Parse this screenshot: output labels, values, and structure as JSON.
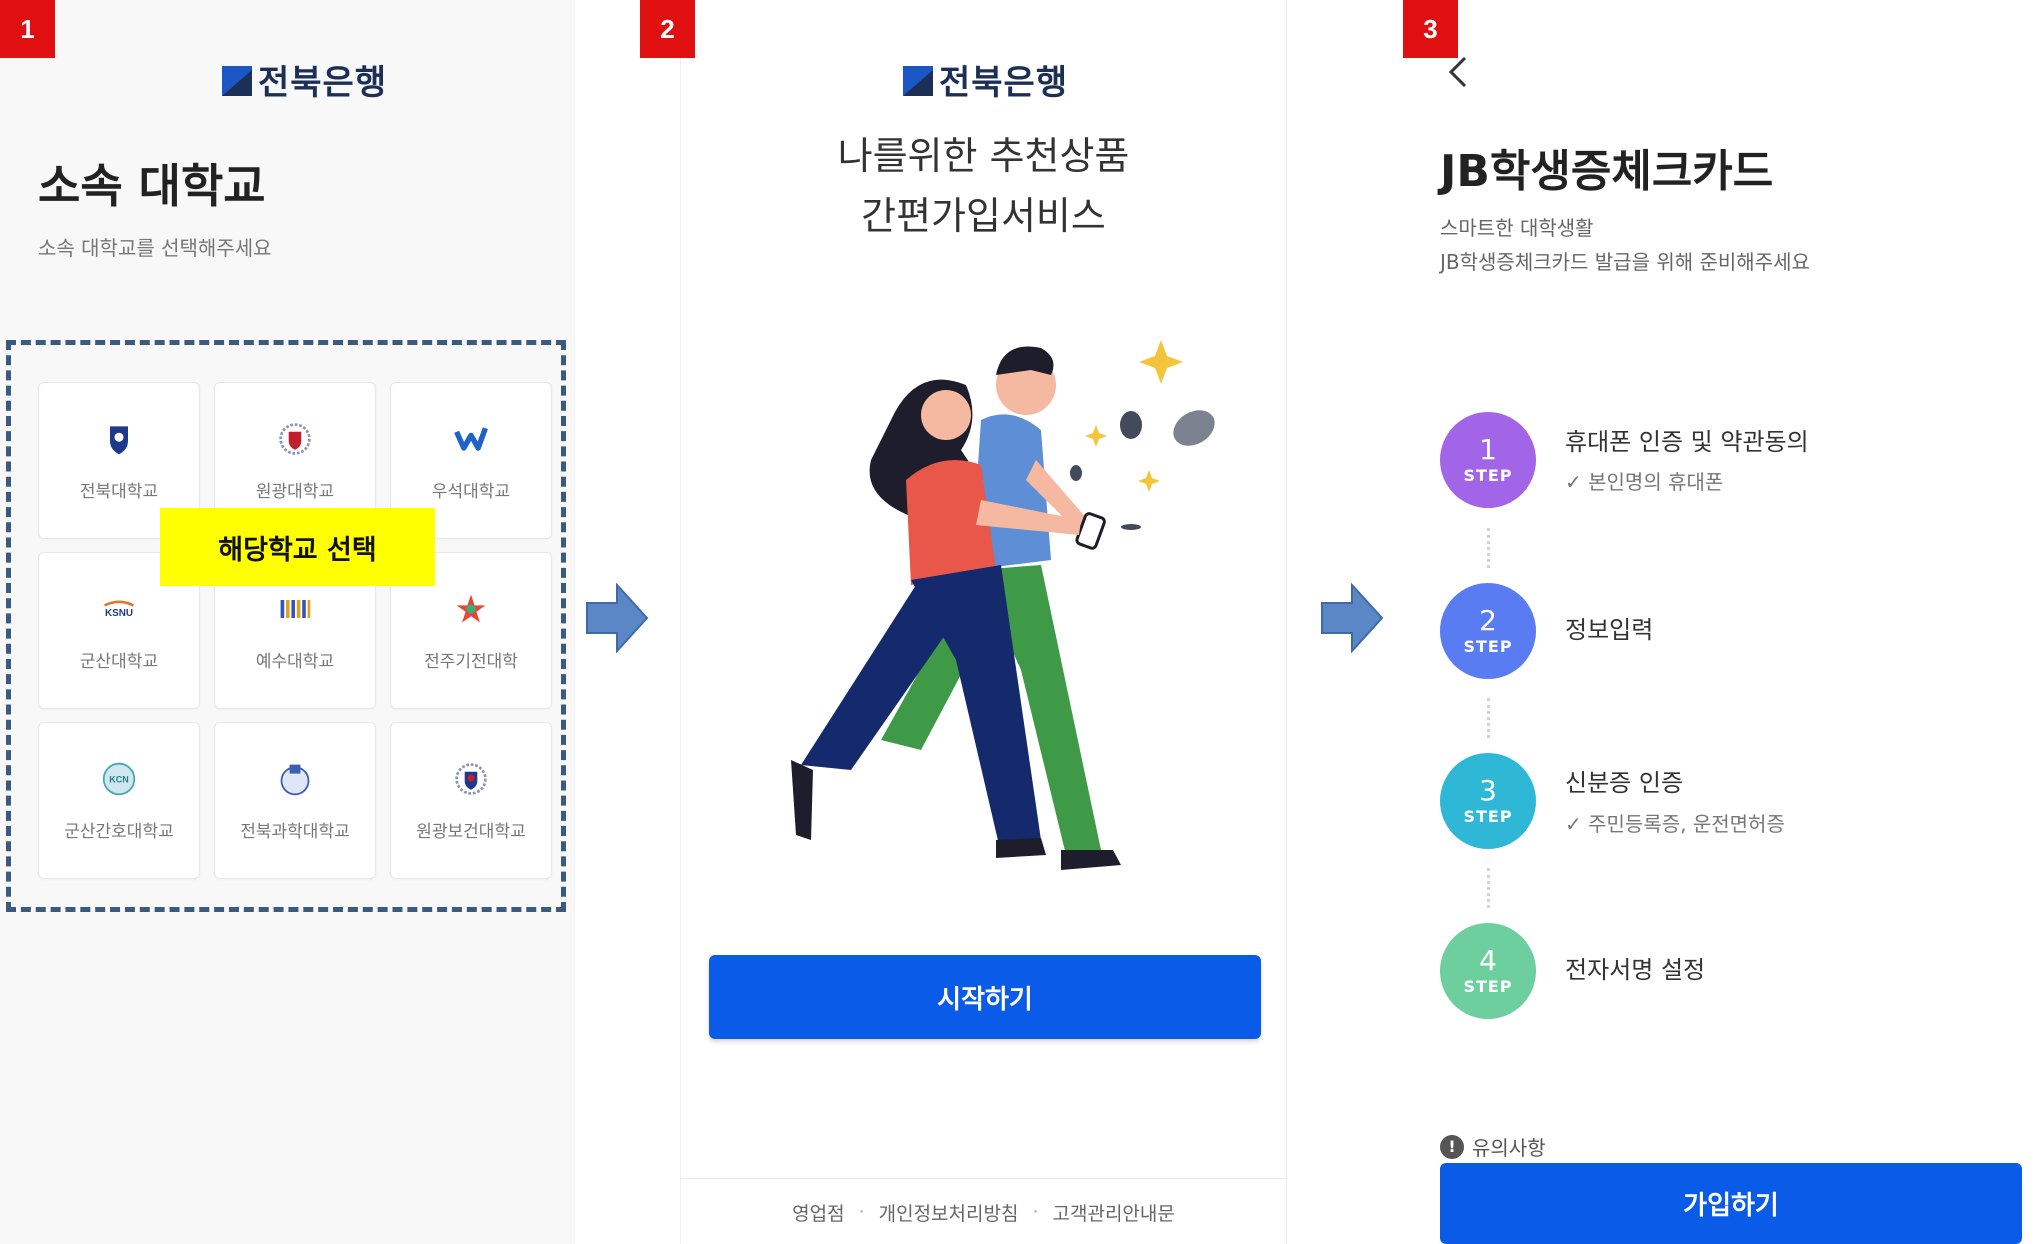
{
  "badges": [
    "1",
    "2",
    "3"
  ],
  "bank_logo": "전북은행",
  "panel1": {
    "title": "소속 대학교",
    "subtitle": "소속 대학교를 선택해주세요",
    "highlight": "해당학교 선택",
    "universities": [
      {
        "name": "전북대학교",
        "icon": "jbnu-crest-icon"
      },
      {
        "name": "원광대학교",
        "icon": "wku-crest-icon"
      },
      {
        "name": "우석대학교",
        "icon": "woosuk-w-icon"
      },
      {
        "name": "군산대학교",
        "icon": "ksnu-logo-icon"
      },
      {
        "name": "예수대학교",
        "icon": "jesus-univ-icon"
      },
      {
        "name": "전주기전대학",
        "icon": "kijeon-star-icon"
      },
      {
        "name": "군산간호대학교",
        "icon": "kcn-seal-icon"
      },
      {
        "name": "전북과학대학교",
        "icon": "jbsc-seal-icon"
      },
      {
        "name": "원광보건대학교",
        "icon": "wkhc-crest-icon"
      }
    ]
  },
  "panel2": {
    "headline1": "나를위한 추천상품",
    "headline2": "간편가입서비스",
    "start_button": "시작하기",
    "footer": [
      "영업점",
      "개인정보처리방침",
      "고객관리안내문"
    ]
  },
  "panel3": {
    "title": "JB학생증체크카드",
    "subtitle1": "스마트한 대학생활",
    "subtitle2": "JB학생증체크카드 발급을 위해 준비해주세요",
    "steps": [
      {
        "num": "1",
        "word": "STEP",
        "title": "휴대폰 인증 및 약관동의",
        "detail": "본인명의 휴대폰",
        "color": "#a265e8"
      },
      {
        "num": "2",
        "word": "STEP",
        "title": "정보입력",
        "detail": "",
        "color": "#5a7cf2"
      },
      {
        "num": "3",
        "word": "STEP",
        "title": "신분증 인증",
        "detail": "주민등록증, 운전면허증",
        "color": "#2fb8d6"
      },
      {
        "num": "4",
        "word": "STEP",
        "title": "전자서명 설정",
        "detail": "",
        "color": "#6ecf9e"
      }
    ],
    "notice": "유의사항",
    "join_button": "가입하기"
  },
  "colors": {
    "primary_blue": "#0a5ce8",
    "badge_red": "#e01010",
    "highlight_yellow": "#ffff00",
    "arrow_blue": "#5b87c6"
  }
}
